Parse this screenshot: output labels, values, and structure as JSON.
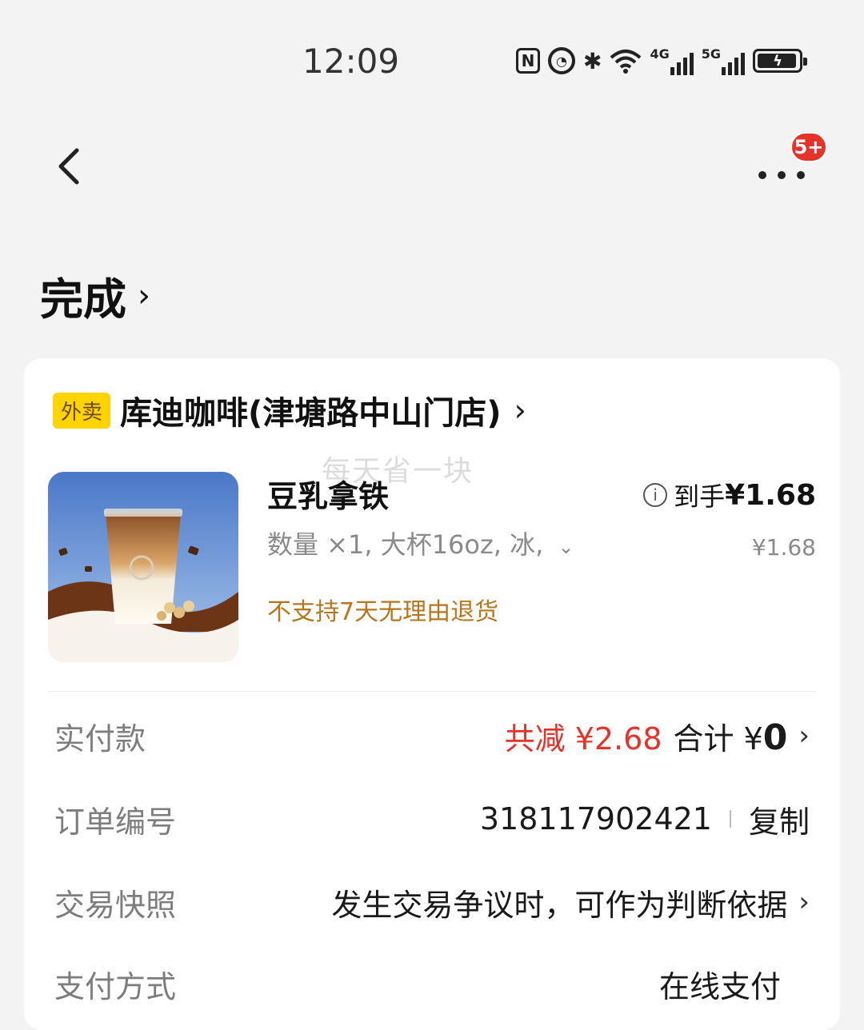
{
  "status": {
    "time": "12:09",
    "net1": "4G",
    "net2": "5G"
  },
  "nav": {
    "badge": "5+"
  },
  "page": {
    "title": "完成"
  },
  "store": {
    "tag": "外卖",
    "name": "库迪咖啡(津塘路中山门店)"
  },
  "watermark": "每天省一块",
  "product": {
    "name": "豆乳拿铁",
    "spec": "数量 ×1, 大杯16oz, 冰,",
    "notice": "不支持7天无理由退货",
    "final_label": "到手",
    "final_price": "¥1.68",
    "orig_price": "¥1.68"
  },
  "details": [
    {
      "label": "实付款",
      "discount": "共减 ¥2.68",
      "total_label": "合计 ¥",
      "total_value": "0"
    },
    {
      "label": "订单编号",
      "value": "318117902421",
      "action": "复制"
    },
    {
      "label": "交易快照",
      "value": "发生交易争议时，可作为判断依据"
    },
    {
      "label": "支付方式",
      "value": "在线支付"
    }
  ]
}
